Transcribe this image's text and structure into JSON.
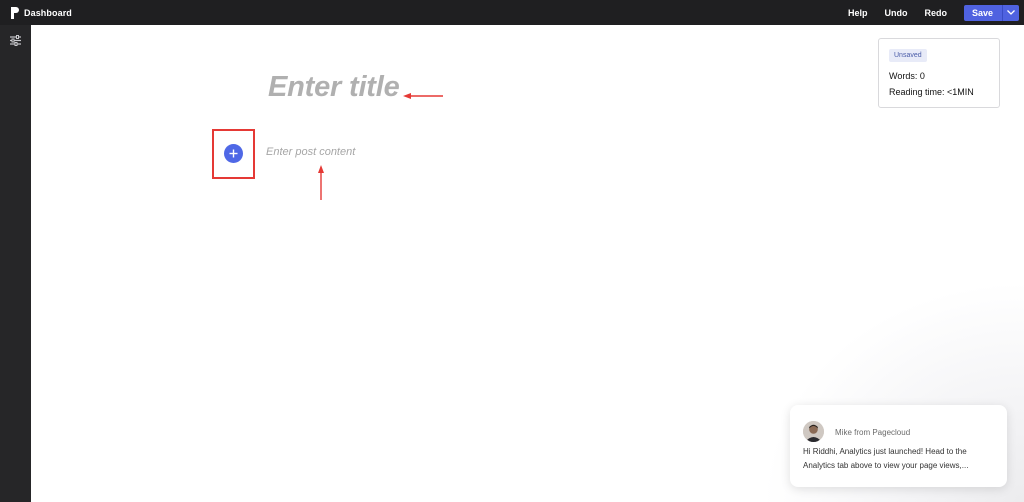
{
  "header": {
    "brand": "Dashboard",
    "help_label": "Help",
    "undo_label": "Undo",
    "redo_label": "Redo",
    "save_label": "Save"
  },
  "editor": {
    "title_placeholder": "Enter title",
    "content_placeholder": "Enter post content"
  },
  "stats": {
    "status_badge": "Unsaved",
    "words": "Words: 0",
    "reading_time": "Reading time: <1MIN"
  },
  "chat": {
    "from": "Mike from Pagecloud",
    "message": "Hi Riddhi, Analytics just launched! Head to the Analytics tab above to view your page views,..."
  },
  "colors": {
    "topbar": "#1f1f21",
    "sidebar": "#262628",
    "accent": "#4f62e0",
    "annotation": "#e53935"
  },
  "icons": {
    "logo": "pagecloud-logo-icon",
    "caret": "chevron-down-icon",
    "settings": "sliders-icon",
    "add": "plus-icon",
    "avatar": "avatar"
  }
}
